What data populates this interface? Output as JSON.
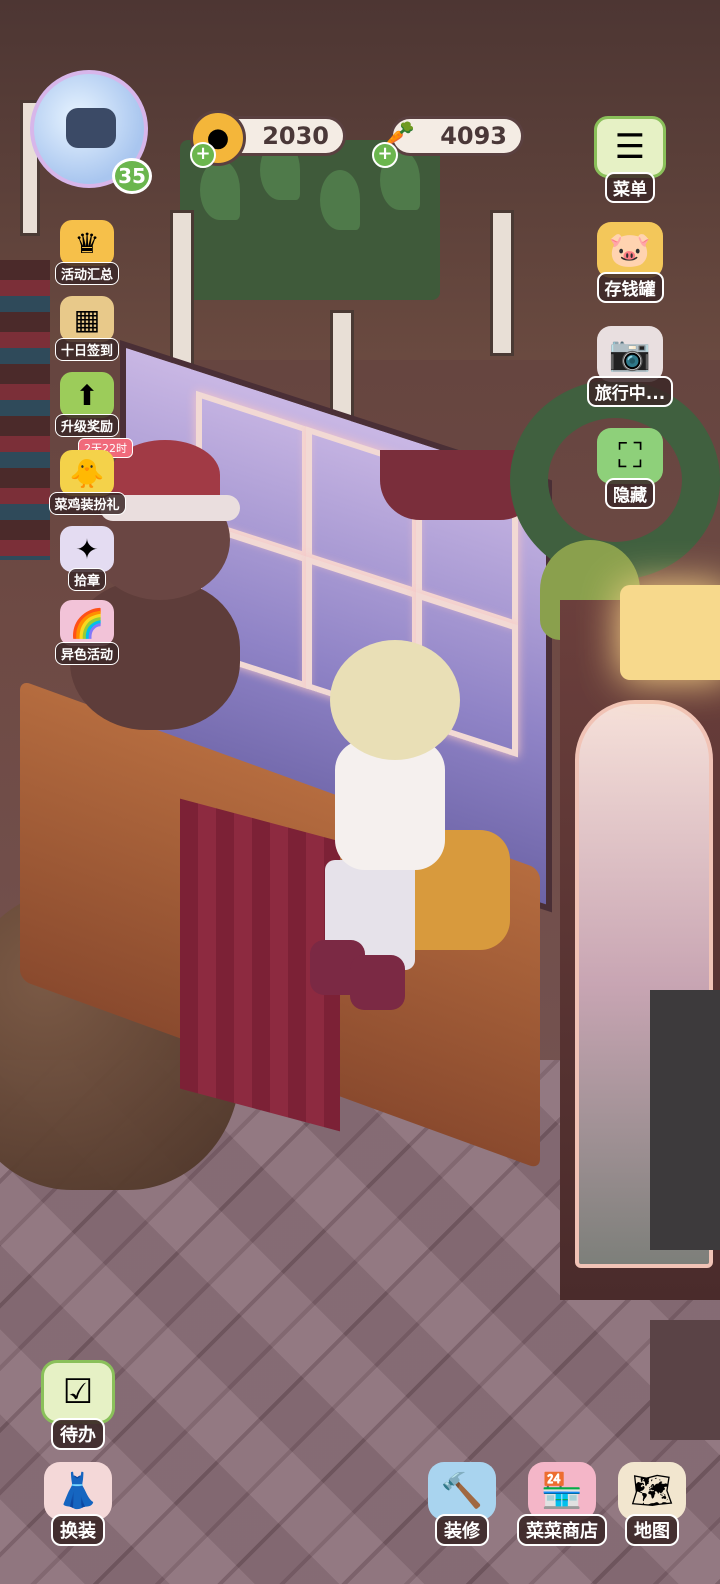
{
  "player": {
    "level": "35"
  },
  "resources": {
    "coins": {
      "value": "2030",
      "icon": "coin-icon"
    },
    "carrots": {
      "value": "4093",
      "icon": "carrot-icon"
    }
  },
  "left_menu": [
    {
      "label": "活动汇总",
      "icon": "crown-icon"
    },
    {
      "label": "十日签到",
      "icon": "calendar-icon"
    },
    {
      "label": "升级奖励",
      "icon": "arrow-up-icon"
    },
    {
      "label": "菜鸡装扮礼",
      "icon": "chick-icon",
      "timer": "2天22时"
    },
    {
      "label": "拾章",
      "icon": "badge-icon"
    },
    {
      "label": "异色活动",
      "icon": "rainbow-icon"
    }
  ],
  "right_menu": [
    {
      "label": "菜单",
      "icon": "menu-icon"
    },
    {
      "label": "存钱罐",
      "icon": "piggy-bank-icon"
    },
    {
      "label": "旅行中...",
      "icon": "camera-icon"
    },
    {
      "label": "隐藏",
      "icon": "hide-icon"
    }
  ],
  "bottom_left": [
    {
      "label": "待办",
      "icon": "todo-icon"
    },
    {
      "label": "换装",
      "icon": "outfit-icon"
    }
  ],
  "bottom_right": [
    {
      "label": "装修",
      "icon": "decorate-icon"
    },
    {
      "label": "菜菜商店",
      "icon": "shop-icon"
    },
    {
      "label": "地图",
      "icon": "map-icon"
    }
  ]
}
